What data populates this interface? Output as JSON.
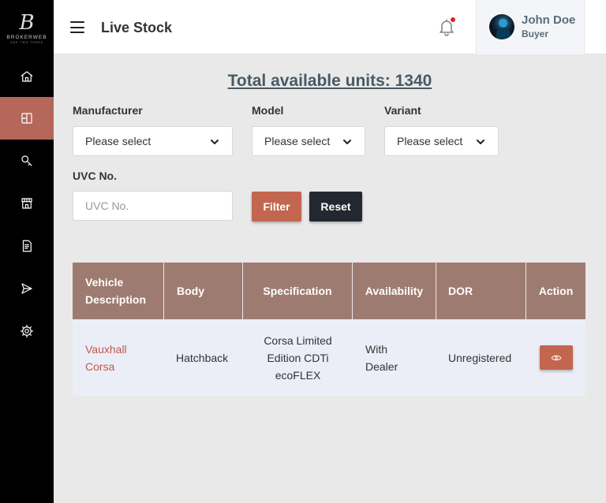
{
  "brand": {
    "mark": "B",
    "name": "BROKERWEB",
    "tagline": "ONE TWO THREE"
  },
  "header": {
    "title": "Live Stock"
  },
  "user": {
    "name": "John Doe",
    "role": "Buyer"
  },
  "summary": {
    "total_text": "Total available units: 1340"
  },
  "filters": {
    "manufacturer": {
      "label": "Manufacturer",
      "value": "Please select"
    },
    "model": {
      "label": "Model",
      "value": "Please select"
    },
    "variant": {
      "label": "Variant",
      "value": "Please select"
    },
    "uvc": {
      "label": "UVC No.",
      "placeholder": "UVC No."
    },
    "filter_label": "Filter",
    "reset_label": "Reset"
  },
  "table": {
    "headers": [
      "Vehicle Description",
      "Body",
      "Specification",
      "Availability",
      "DOR",
      "Action"
    ],
    "rows": [
      {
        "vehicle": "Vauxhall Corsa",
        "body": "Hatchback",
        "specification": "Corsa Limited Edition CDTi ecoFLEX",
        "availability": "With Dealer",
        "dor": "Unregistered",
        "action_icon": "eye-icon"
      }
    ]
  },
  "nav_icons": [
    "home-icon",
    "layout-icon",
    "search-key-icon",
    "store-icon",
    "document-icon",
    "send-icon",
    "gear-icon"
  ],
  "colors": {
    "accent": "#b5685a",
    "button": "#c2664f",
    "dark": "#232830",
    "table_header": "#9e7b70",
    "row_bg": "#ebeef6",
    "link": "#c2574a"
  }
}
